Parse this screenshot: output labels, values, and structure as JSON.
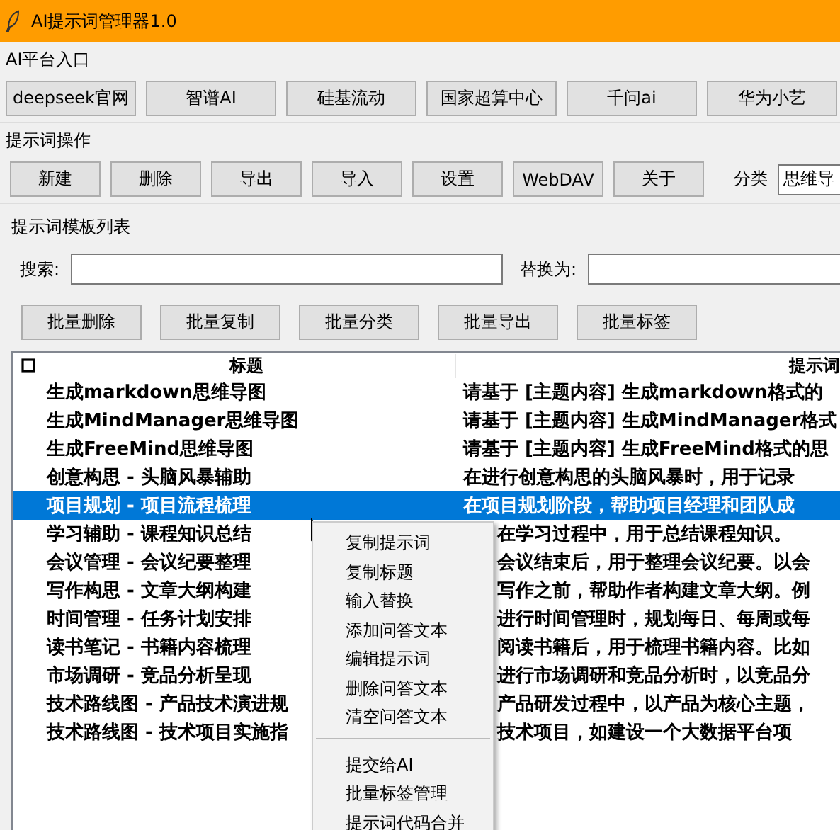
{
  "window": {
    "title": "AI提示词管理器1.0"
  },
  "platforms": {
    "label": "AI平台入口",
    "buttons": [
      "deepseek官网",
      "智谱AI",
      "硅基流动",
      "国家超算中心",
      "千问ai",
      "华为小艺"
    ]
  },
  "operations": {
    "label": "提示词操作",
    "buttons": [
      "新建",
      "删除",
      "导出",
      "导入",
      "设置",
      "WebDAV",
      "关于"
    ],
    "category_label": "分类",
    "category_value": "思维导"
  },
  "templates": {
    "label": "提示词模板列表",
    "search_label": "搜索:",
    "replace_label": "替换为:",
    "batch_buttons": [
      "批量删除",
      "批量复制",
      "批量分类",
      "批量导出",
      "批量标签"
    ],
    "columns": [
      "标题",
      "提示词"
    ],
    "rows": [
      {
        "title": "生成markdown思维导图",
        "prompt": "请基于 [主题内容] 生成markdown格式的",
        "selected": false
      },
      {
        "title": "生成MindManager思维导图",
        "prompt": "请基于 [主题内容] 生成MindManager格式",
        "selected": false
      },
      {
        "title": "生成FreeMind思维导图",
        "prompt": "请基于 [主题内容] 生成FreeMind格式的思",
        "selected": false
      },
      {
        "title": "创意构思 - 头脑风暴辅助",
        "prompt": "在进行创意构思的头脑风暴时，用于记录",
        "selected": false
      },
      {
        "title": "项目规划 - 项目流程梳理",
        "prompt": "在项目规划阶段，帮助项目经理和团队成",
        "selected": true
      },
      {
        "title": "学习辅助 - 课程知识总结",
        "prompt": "在学习过程中，用于总结课程知识。",
        "selected": false
      },
      {
        "title": "会议管理 - 会议纪要整理",
        "prompt": "会议结束后，用于整理会议纪要。以会",
        "selected": false
      },
      {
        "title": "写作构思 - 文章大纲构建",
        "prompt": "写作之前，帮助作者构建文章大纲。例",
        "selected": false
      },
      {
        "title": "时间管理 - 任务计划安排",
        "prompt": "进行时间管理时，规划每日、每周或每",
        "selected": false
      },
      {
        "title": "读书笔记 - 书籍内容梳理",
        "prompt": "阅读书籍后，用于梳理书籍内容。比如",
        "selected": false
      },
      {
        "title": "市场调研 - 竞品分析呈现",
        "prompt": "进行市场调研和竞品分析时，以竞品分",
        "selected": false
      },
      {
        "title": "技术路线图 - 产品技术演进规",
        "prompt": "产品研发过程中，以产品为核心主题，",
        "selected": false
      },
      {
        "title": "技术路线图 - 技术项目实施指",
        "prompt": "技术项目，如建设一个大数据平台项",
        "selected": false
      }
    ]
  },
  "context_menu": {
    "groups": [
      [
        "复制提示词",
        "复制标题",
        "输入替换",
        "添加问答文本",
        "编辑提示词",
        "删除问答文本",
        "清空问答文本"
      ],
      [
        "提交给AI",
        "批量标签管理",
        "提示词代码合并"
      ]
    ]
  }
}
